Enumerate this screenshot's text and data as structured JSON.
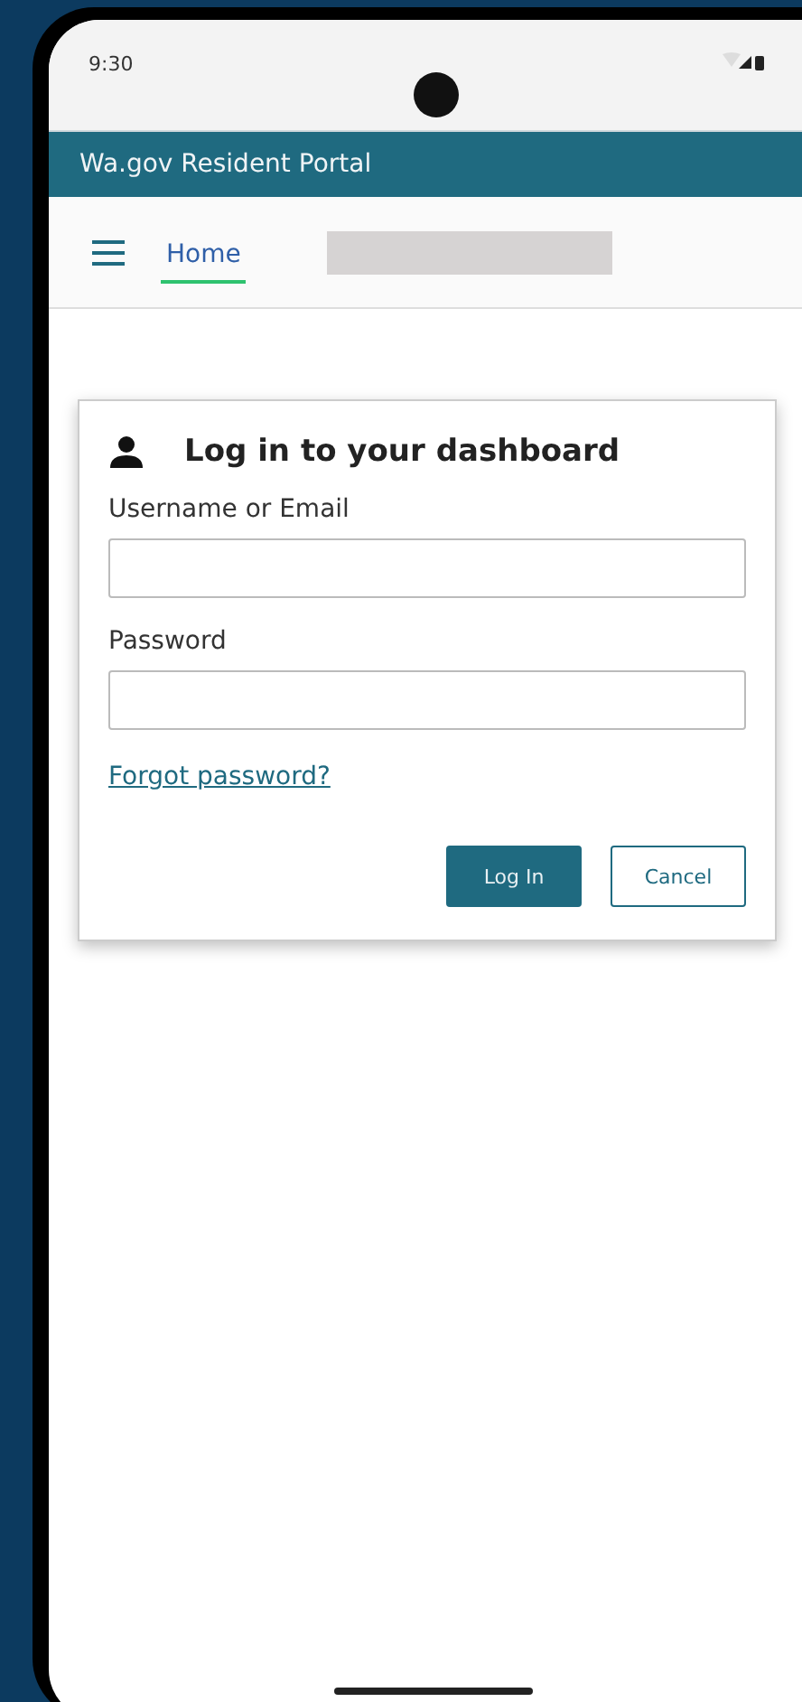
{
  "status_bar": {
    "time": "9:30"
  },
  "header": {
    "title": "Wa.gov Resident Portal"
  },
  "nav": {
    "tabs": [
      {
        "label": "Home",
        "selected": true
      }
    ]
  },
  "login": {
    "title": "Log in to your dashboard",
    "fields": [
      {
        "label": "Username or Email"
      },
      {
        "label": "Password"
      }
    ],
    "link": "Forgot password?",
    "buttons": [
      {
        "label": "Log In",
        "kind": "primary"
      },
      {
        "label": "Cancel",
        "kind": "secondary"
      }
    ]
  }
}
